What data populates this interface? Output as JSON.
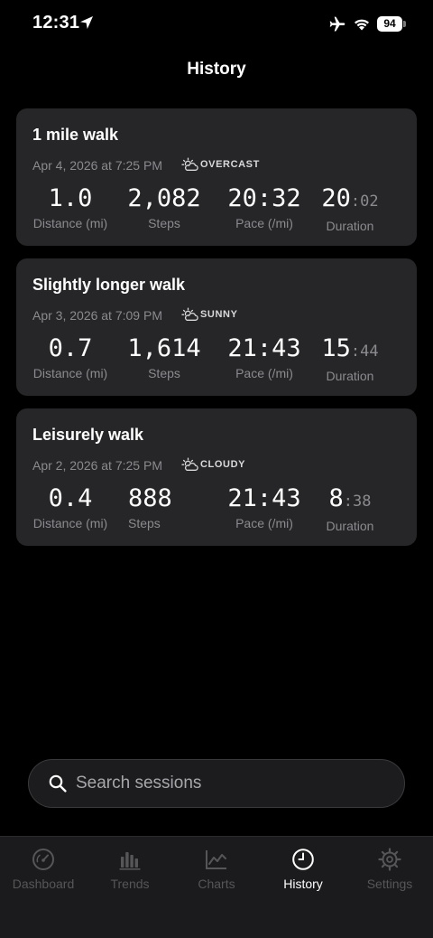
{
  "status_bar": {
    "time": "12:31",
    "battery": "94"
  },
  "header": {
    "title": "History"
  },
  "sessions": [
    {
      "title": "1 mile walk",
      "date": "Apr 4, 2026 at 7:25 PM",
      "weather": "OVERCAST",
      "distance": "1.0",
      "steps": "2,082",
      "pace": "20:32",
      "duration_min": "20",
      "duration_sec": ":02"
    },
    {
      "title": "Slightly longer walk",
      "date": "Apr 3, 2026 at 7:09 PM",
      "weather": "SUNNY",
      "distance": "0.7",
      "steps": "1,614",
      "pace": "21:43",
      "duration_min": "15",
      "duration_sec": ":44"
    },
    {
      "title": "Leisurely walk",
      "date": "Apr 2, 2026 at 7:25 PM",
      "weather": "CLOUDY",
      "distance": "0.4",
      "steps": "888",
      "pace": "21:43",
      "duration_min": "8",
      "duration_sec": ":38"
    }
  ],
  "labels": {
    "distance": "Distance (mi)",
    "steps": "Steps",
    "pace": "Pace (/mi)",
    "duration": "Duration"
  },
  "search": {
    "placeholder": "Search sessions"
  },
  "tabs": [
    {
      "label": "Dashboard",
      "icon": "gauge-icon"
    },
    {
      "label": "Trends",
      "icon": "bar-chart-icon"
    },
    {
      "label": "Charts",
      "icon": "line-chart-icon"
    },
    {
      "label": "History",
      "icon": "clock-icon",
      "active": true
    },
    {
      "label": "Settings",
      "icon": "gear-icon"
    }
  ],
  "colors": {
    "background": "#000000",
    "card": "#262628",
    "secondary_text": "#8b8b8f",
    "tab_inactive": "#565658",
    "tab_active": "#ffffff"
  }
}
